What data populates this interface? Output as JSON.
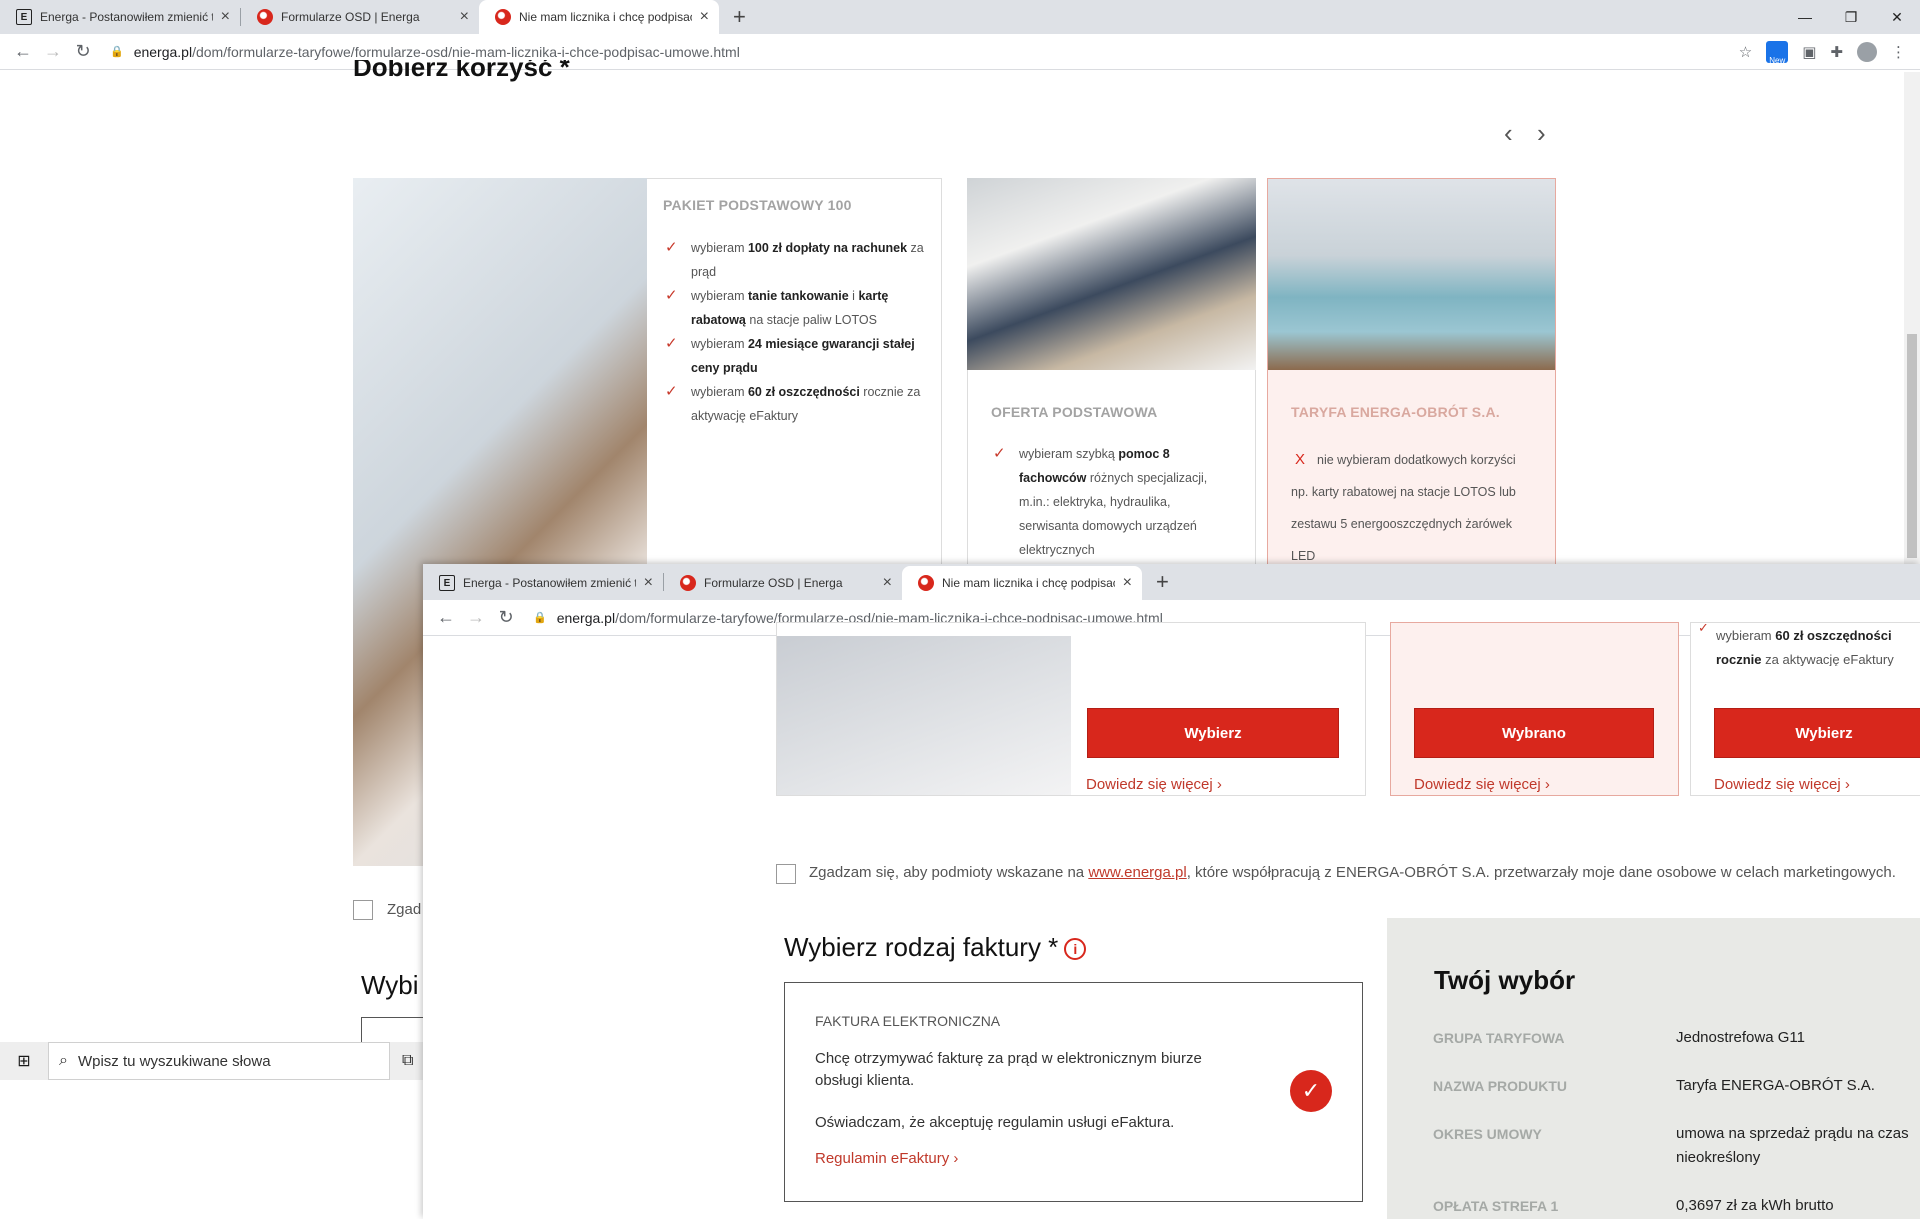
{
  "browser_back": {
    "tabs": [
      {
        "title": "Energa - Postanowiłem zmienić t",
        "favicon": "energa-e-icon"
      },
      {
        "title": "Formularze OSD | Energa",
        "favicon": "energa-flame-icon"
      },
      {
        "title": "Nie mam licznika i chcę podpisać",
        "favicon": "energa-flame-icon"
      }
    ],
    "url_host": "energa.pl",
    "url_path": "/dom/formularze-taryfowe/formularze-osd/nie-mam-licznika-i-chce-podpisac-umowe.html",
    "ext_new_label": "New"
  },
  "back_page": {
    "heading_partial": "Dobierz korzyść *",
    "cards": [
      {
        "title": "PAKIET PODSTAWOWY 100",
        "benefits": [
          {
            "pre": "wybieram ",
            "bold": "100 zł dopłaty na rachunek",
            "post": " za prąd"
          },
          {
            "pre": "wybieram ",
            "bold": "tanie tankowanie",
            "post": " i ",
            "bold2": "kartę rabatową",
            "post2": " na stacje paliw LOTOS"
          },
          {
            "pre": "wybieram ",
            "bold": "24 miesiące gwarancji stałej ceny prądu",
            "post": ""
          },
          {
            "pre": "wybieram ",
            "bold": "60 zł oszczędności",
            "post": " rocznie za aktywację eFaktury"
          }
        ]
      },
      {
        "title": "OFERTA PODSTAWOWA",
        "benefits": [
          {
            "pre": "wybieram szybką ",
            "bold": "pomoc 8 fachowców",
            "post": " różnych specjalizacji, m.in.: elektryka, hydraulika, serwisanta domowych urządzeń elektrycznych"
          }
        ]
      },
      {
        "title": "TARYFA ENERGA-OBRÓT S.A.",
        "cross_text": "nie wybieram dodatkowych korzyści np. karty rabatowej na stacje LOTOS lub zestawu 5 energooszczędnych żarówek LED"
      }
    ],
    "consent_partial": "Zgad",
    "h2_partial": "Wybi"
  },
  "browser_front": {
    "tabs": [
      {
        "title": "Energa - Postanowiłem zmienić t",
        "favicon": "energa-e-icon"
      },
      {
        "title": "Formularze OSD | Energa",
        "favicon": "energa-flame-icon"
      },
      {
        "title": "Nie mam licznika i chcę podpisać",
        "favicon": "energa-flame-icon"
      }
    ],
    "url_host": "energa.pl",
    "url_path": "/dom/formularze-taryfowe/formularze-osd/nie-mam-licznika-i-chce-podpisac-umowe.html"
  },
  "front_page": {
    "cards": [
      {
        "button": "Wybierz",
        "more": "Dowiedz się więcej ›"
      },
      {
        "button": "Wybrano",
        "more": "Dowiedz się więcej ›"
      },
      {
        "button": "Wybierz",
        "more": "Dowiedz się więcej ›",
        "top_pre": "wybieram ",
        "top_bold": "60 zł oszczędności rocznie",
        "top_post": " za aktywację eFaktury"
      }
    ],
    "consent": {
      "pre": "Zgadzam się, aby podmioty wskazane na ",
      "link": "www.energa.pl",
      "post": ", które współpracują z ENERGA-OBRÓT S.A. przetwarzały moje dane osobowe w celach marketingowych."
    },
    "invoice": {
      "heading": "Wybierz rodzaj faktury *",
      "info_glyph": "i",
      "type_title": "FAKTURA ELEKTRONICZNA",
      "desc1": "Chcę otrzymywać fakturę za prąd w elektronicznym biurze obsługi klienta.",
      "desc2": "Oświadczam, że akceptuję regulamin usługi eFaktura.",
      "link": "Regulamin eFaktury ›"
    },
    "summary": {
      "title": "Twój wybór",
      "rows": [
        {
          "label": "GRUPA TARYFOWA",
          "value": "Jednostrefowa G11"
        },
        {
          "label": "NAZWA PRODUKTU",
          "value": "Taryfa ENERGA-OBRÓT S.A."
        },
        {
          "label": "OKRES UMOWY",
          "value": "umowa na sprzedaż prądu na czas nieokreślony"
        },
        {
          "label": "OPŁATA STREFA 1",
          "value": "0,3697 zł za kWh brutto"
        }
      ]
    }
  },
  "taskbar": {
    "search_placeholder": "Wpisz tu wyszukiwane słowa"
  }
}
